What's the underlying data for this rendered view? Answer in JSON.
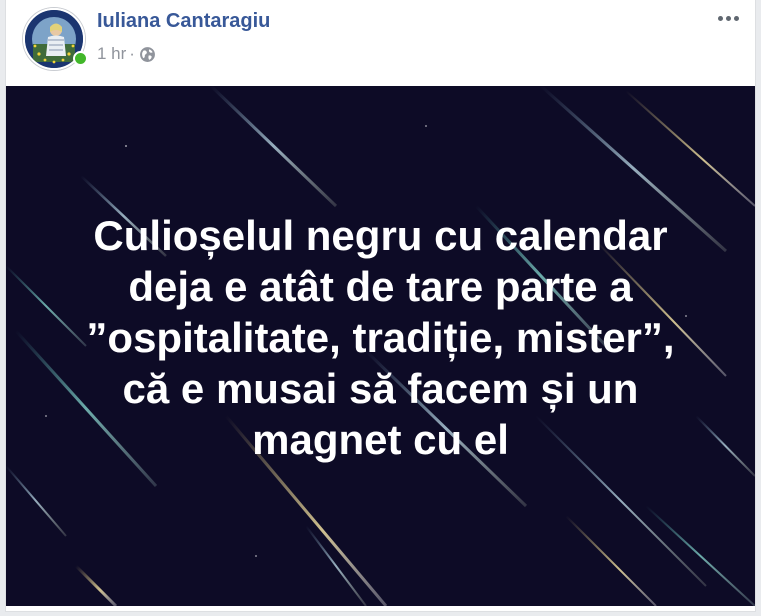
{
  "post": {
    "author_name": "Iuliana Cantaragiu",
    "timestamp": "1 hr",
    "separator": "·",
    "privacy_icon": "globe-icon",
    "more_icon": "more-options-icon",
    "online_status": "online",
    "text": "Culioșelul negru cu calendar\ndeja e atât de tare parte a\n”ospitalitate, tradiție, mister”,\ncă e musai să facem și un\nmagnet cu el",
    "background": "starry night sky with meteor streaks"
  },
  "colors": {
    "author_link": "#385898",
    "meta_text": "#90949c",
    "online_dot": "#42b72a",
    "card_background": "#0d0b26",
    "card_text": "#ffffff"
  }
}
